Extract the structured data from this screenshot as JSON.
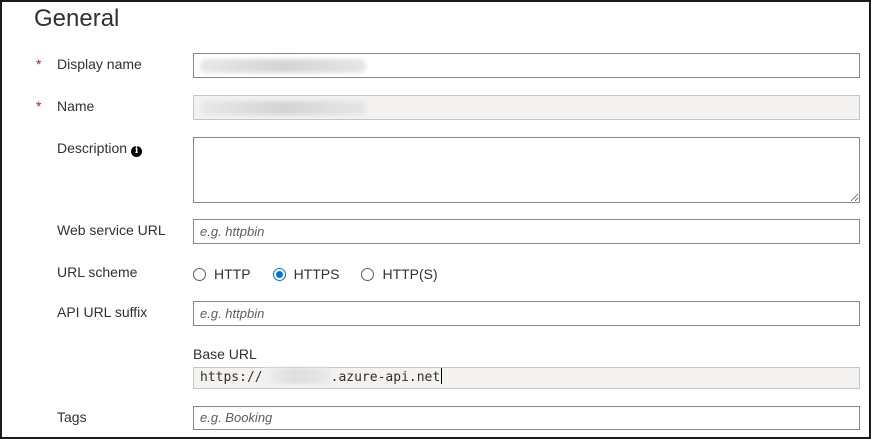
{
  "section": {
    "title": "General"
  },
  "form": {
    "display_name": {
      "label": "Display name",
      "required_mark": "*",
      "value": ""
    },
    "name": {
      "label": "Name",
      "required_mark": "*",
      "value": ""
    },
    "description": {
      "label": "Description",
      "info_icon": "info-icon",
      "value": ""
    },
    "web_service_url": {
      "label": "Web service URL",
      "placeholder": "e.g. httpbin"
    },
    "url_scheme": {
      "label": "URL scheme",
      "options": [
        "HTTP",
        "HTTPS",
        "HTTP(S)"
      ],
      "selected": "HTTPS"
    },
    "api_url_suffix": {
      "label": "API URL suffix",
      "placeholder": "e.g. httpbin"
    },
    "base_url": {
      "label": "Base URL",
      "prefix": "https://",
      "suffix": ".azure-api.net"
    },
    "tags": {
      "label": "Tags",
      "placeholder": "e.g. Booking"
    }
  },
  "colors": {
    "required": "#a4262c",
    "accent": "#0078d4",
    "border": "#8a8886",
    "disabled_bg": "#f3f2f1"
  }
}
